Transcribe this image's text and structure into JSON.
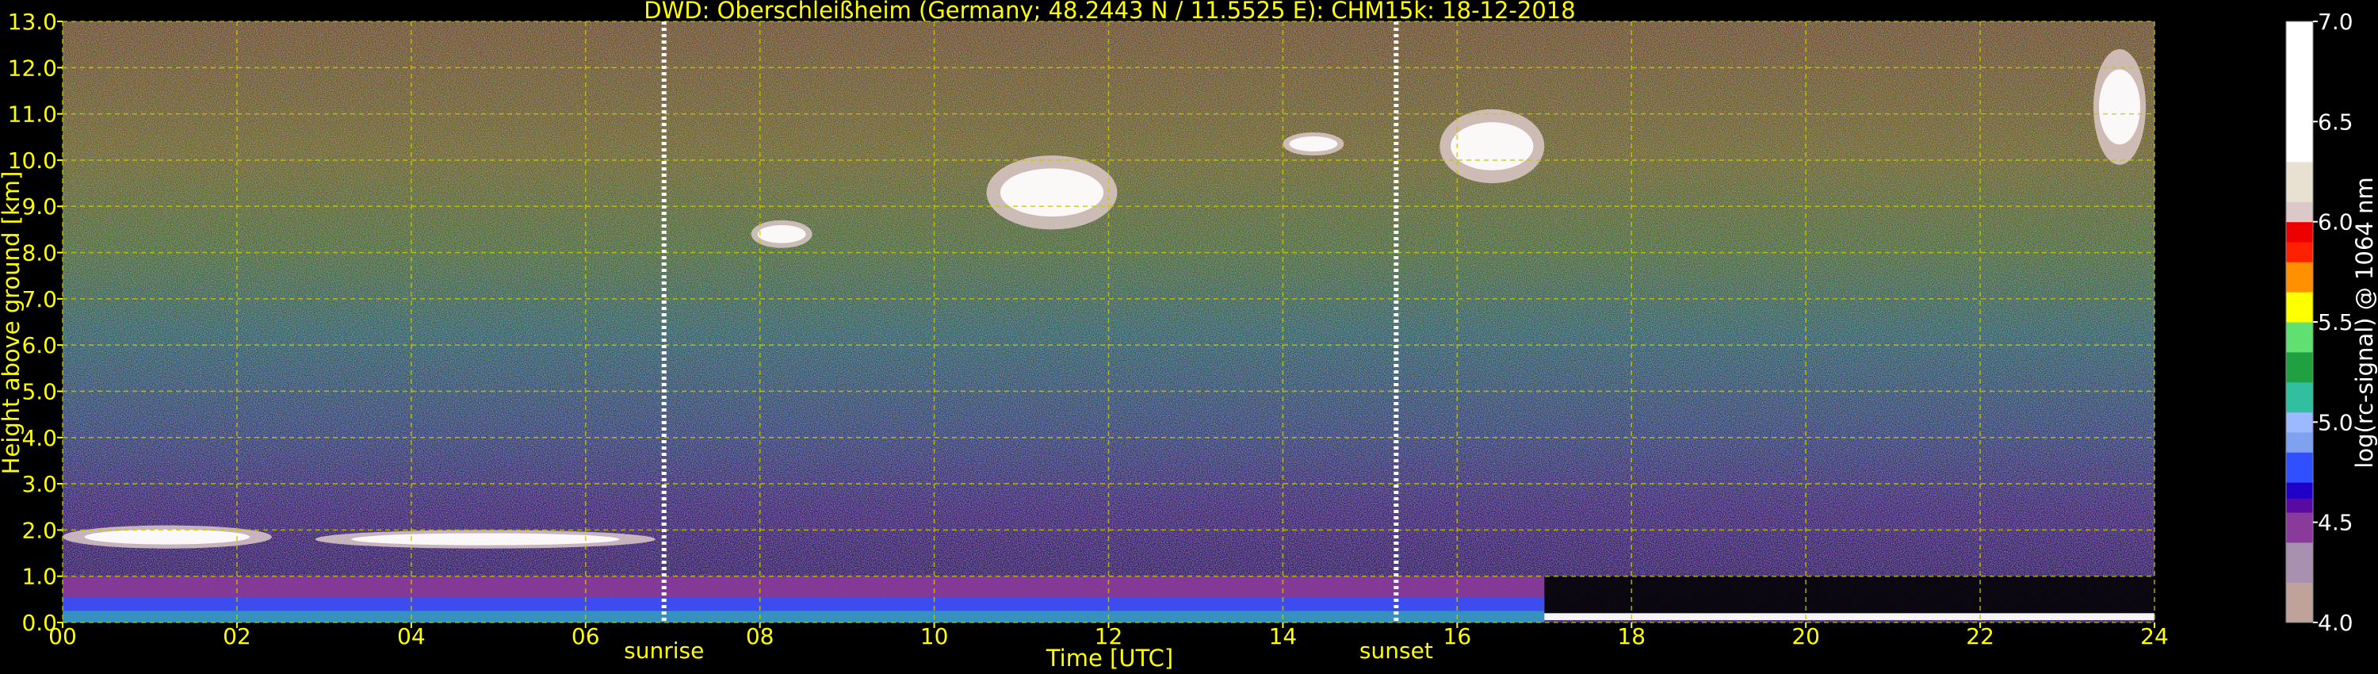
{
  "chart_data": {
    "type": "heatmap",
    "title": "DWD: Oberschleißheim (Germany; 48.2443 N / 11.5525 E):    CHM15k: 18-12-2018",
    "xlabel": "Time [UTC]",
    "ylabel": "Height above ground [km]",
    "xlim": [
      0,
      24
    ],
    "ylim": [
      0,
      13
    ],
    "x_ticks": [
      "00",
      "02",
      "04",
      "06",
      "08",
      "10",
      "12",
      "14",
      "16",
      "18",
      "20",
      "22",
      "24"
    ],
    "y_ticks": [
      "0.0",
      "1.0",
      "2.0",
      "3.0",
      "4.0",
      "5.0",
      "6.0",
      "7.0",
      "8.0",
      "9.0",
      "10.0",
      "11.0",
      "12.0",
      "13.0"
    ],
    "grid": true,
    "events": [
      {
        "label": "sunrise",
        "time": 6.9
      },
      {
        "label": "sunset",
        "time": 15.3
      }
    ],
    "colorbar": {
      "label": "log(rc-signal) @ 1064 nm",
      "range": [
        4.0,
        7.0
      ],
      "ticks": [
        "4.0",
        "4.5",
        "5.0",
        "5.5",
        "6.0",
        "6.5",
        "7.0"
      ]
    },
    "features": [
      {
        "name": "boundary-layer aerosol",
        "time_start": 0.0,
        "time_end": 17.0,
        "height_bottom": 0.0,
        "height_top": 1.0
      },
      {
        "name": "cloud",
        "time_start": 0.0,
        "time_end": 2.4,
        "height_bottom": 1.6,
        "height_top": 2.1
      },
      {
        "name": "cloud",
        "time_start": 2.9,
        "time_end": 6.8,
        "height_bottom": 1.6,
        "height_top": 2.0
      },
      {
        "name": "cloud",
        "time_start": 7.9,
        "time_end": 8.6,
        "height_bottom": 8.1,
        "height_top": 8.7
      },
      {
        "name": "cloud",
        "time_start": 10.6,
        "time_end": 12.1,
        "height_bottom": 8.5,
        "height_top": 10.1
      },
      {
        "name": "cloud",
        "time_start": 14.0,
        "time_end": 14.7,
        "height_bottom": 10.1,
        "height_top": 10.6
      },
      {
        "name": "cloud",
        "time_start": 15.8,
        "time_end": 17.0,
        "height_bottom": 9.5,
        "height_top": 11.1
      },
      {
        "name": "cloud",
        "time_start": 23.3,
        "time_end": 23.9,
        "height_bottom": 9.9,
        "height_top": 12.4
      },
      {
        "name": "low cloud",
        "time_start": 17.0,
        "time_end": 24.0,
        "height_bottom": 0.05,
        "height_top": 0.2
      }
    ]
  },
  "colors": {
    "text": "#ffff00",
    "grid": "#c8c800",
    "background": "#000000",
    "colorbar_stops": [
      [
        4.0,
        "#bfa39b"
      ],
      [
        4.2,
        "#a890b0"
      ],
      [
        4.4,
        "#8a3a9a"
      ],
      [
        4.55,
        "#5a0aa0"
      ],
      [
        4.62,
        "#2000c8"
      ],
      [
        4.7,
        "#3050ff"
      ],
      [
        4.85,
        "#80a0f0"
      ],
      [
        4.95,
        "#9cb8ff"
      ],
      [
        5.05,
        "#30c0a0"
      ],
      [
        5.2,
        "#20a040"
      ],
      [
        5.35,
        "#60e070"
      ],
      [
        5.5,
        "#ffff00"
      ],
      [
        5.65,
        "#ff9000"
      ],
      [
        5.8,
        "#ff2000"
      ],
      [
        5.9,
        "#ee0000"
      ],
      [
        6.0,
        "#dcc8c8"
      ],
      [
        6.1,
        "#e8e0d0"
      ],
      [
        6.3,
        "#ffffff"
      ],
      [
        7.0,
        "#ffffff"
      ]
    ]
  }
}
